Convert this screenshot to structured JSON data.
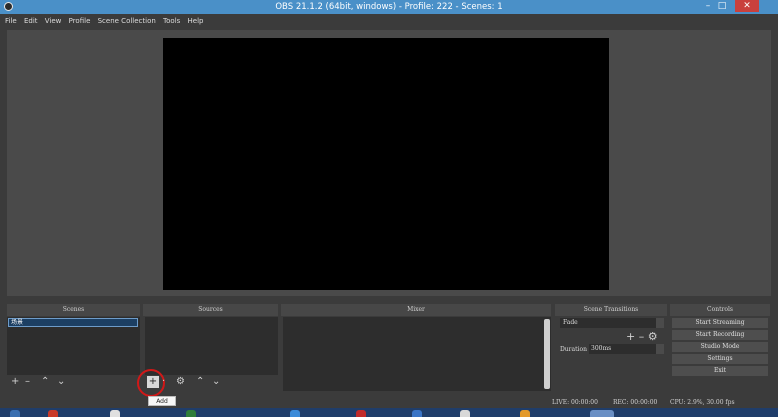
{
  "window": {
    "title": "OBS 21.1.2 (64bit, windows) - Profile: 222 - Scenes: 1"
  },
  "menu": [
    "File",
    "Edit",
    "View",
    "Profile",
    "Scene Collection",
    "Tools",
    "Help"
  ],
  "docks": {
    "scenes": {
      "header": "Scenes",
      "items": [
        "场景"
      ]
    },
    "sources": {
      "header": "Sources"
    },
    "mixer": {
      "header": "Mixer"
    },
    "transitions": {
      "header": "Scene Transitions",
      "selected": "Fade",
      "duration_label": "Duration",
      "duration_value": "300ms"
    },
    "controls": {
      "header": "Controls",
      "buttons": [
        "Start Streaming",
        "Start Recording",
        "Studio Mode",
        "Settings",
        "Exit"
      ]
    }
  },
  "tooltip": "Add",
  "status": {
    "live": "LIVE: 00:00:00",
    "rec": "REC: 00:00:00",
    "cpu": "CPU: 2.9%, 30.00 fps"
  },
  "colors": {
    "titlebar": "#4a90c8",
    "close": "#c9403d",
    "highlight": "#d01818",
    "selected": "#1c3f63"
  },
  "icons": {
    "add": "plus",
    "remove": "minus",
    "settings": "gear",
    "up": "chevron-up",
    "down": "chevron-down"
  }
}
